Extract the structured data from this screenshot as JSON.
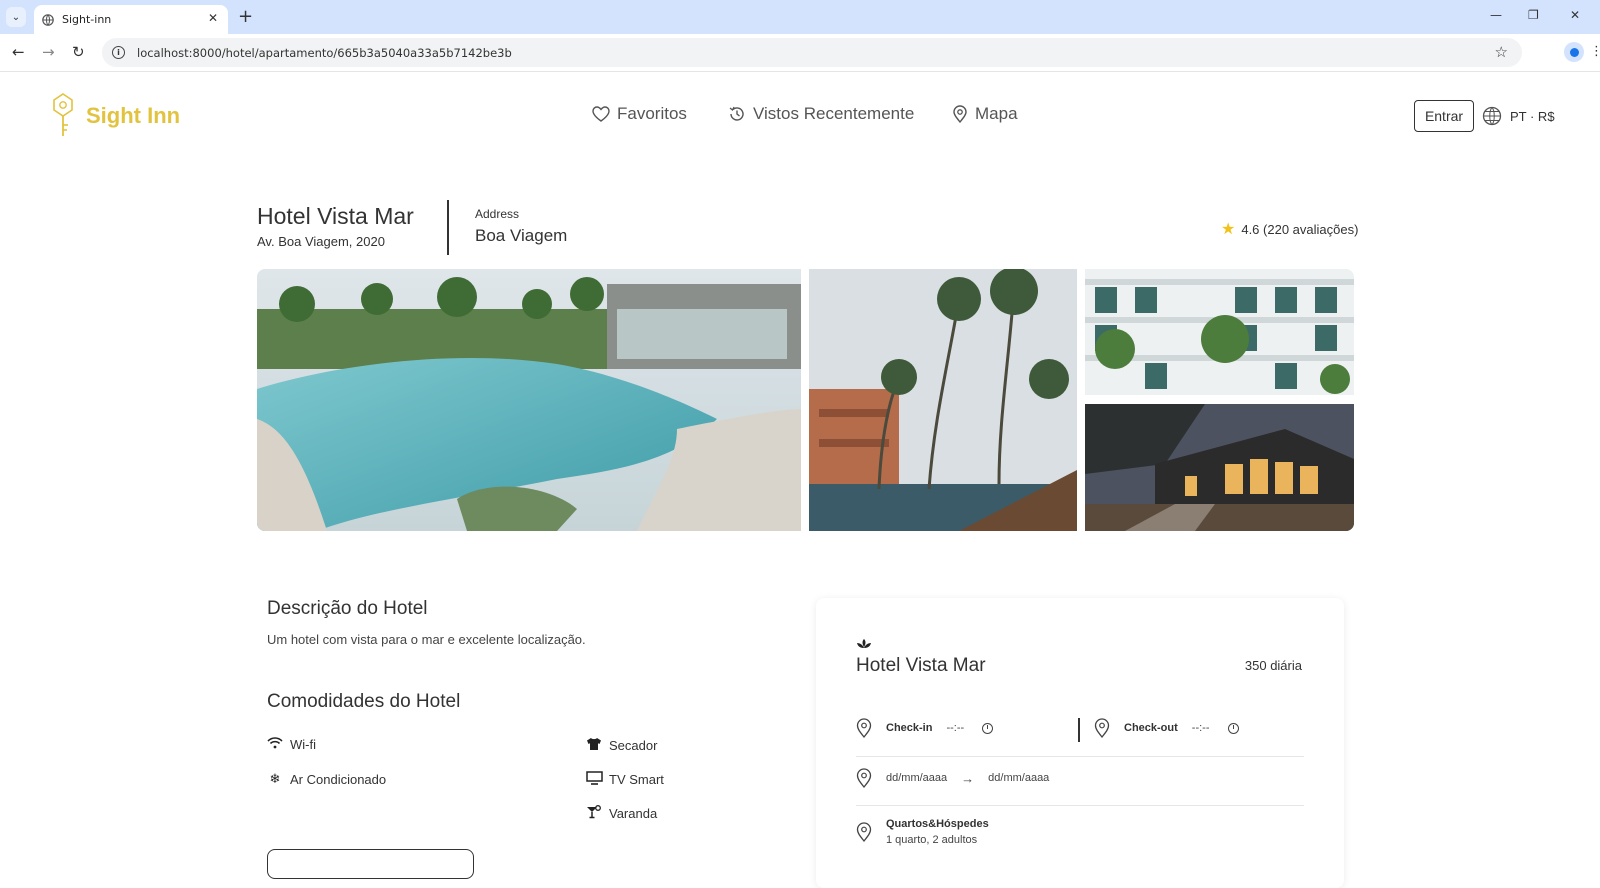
{
  "browser": {
    "tab_title": "Sight-inn",
    "url": "localhost:8000/hotel/apartamento/665b3a5040a33a5b7142be3b"
  },
  "header": {
    "brand": "Sight Inn",
    "nav": {
      "favorites": "Favoritos",
      "recent": "Vistos Recentemente",
      "map": "Mapa"
    },
    "login": "Entrar",
    "locale": "PT · R$"
  },
  "hotel": {
    "name": "Hotel Vista Mar",
    "street": "Av. Boa Viagem, 2020",
    "address_label": "Address",
    "neighborhood": "Boa Viagem",
    "rating_text": "4.6 (220 avaliações)"
  },
  "description": {
    "title": "Descrição do Hotel",
    "text": "Um hotel com vista para o mar e excelente localização."
  },
  "amenities": {
    "title": "Comodidades do Hotel",
    "items": [
      "Wi-fi",
      "Ar Condicionado",
      "Secador",
      "TV Smart",
      "Varanda"
    ]
  },
  "booking": {
    "hotel_name": "Hotel Vista Mar",
    "price": "350 diária",
    "checkin_label": "Check-in",
    "checkin_value": "--:--",
    "checkout_label": "Check-out",
    "checkout_value": "--:--",
    "date_from": "dd/mm/aaaa",
    "date_arrow": "→",
    "date_to": "dd/mm/aaaa",
    "rooms_label": "Quartos&Hóspedes",
    "rooms_value": "1 quarto, 2 adultos"
  },
  "colors": {
    "brand": "#e2c33f",
    "star": "#f2c218",
    "tabbar": "#d3e3fd"
  }
}
